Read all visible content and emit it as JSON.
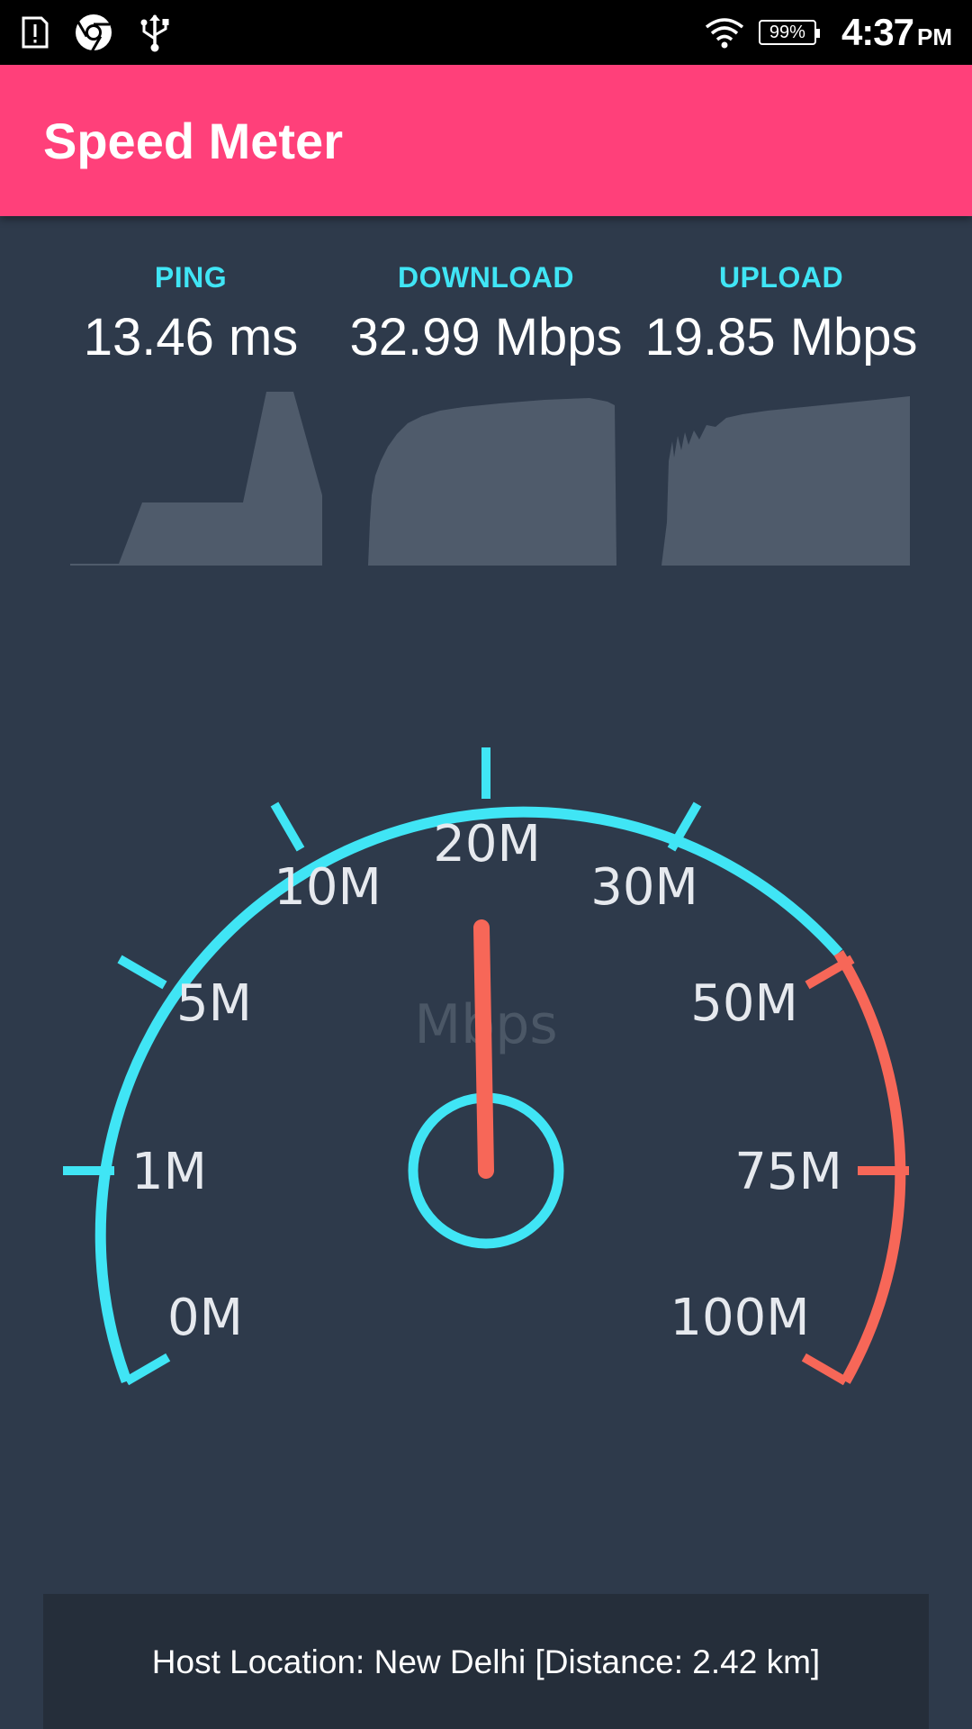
{
  "status_bar": {
    "icons_left": [
      "alert-icon",
      "chrome-icon",
      "usb-icon"
    ],
    "icons_right": [
      "wifi-icon",
      "battery-icon"
    ],
    "battery_percent": "99%",
    "time": "4:37",
    "ampm": "PM"
  },
  "app_bar": {
    "title": "Speed Meter"
  },
  "metrics": {
    "ping": {
      "label": "PING",
      "value": "13.46 ms"
    },
    "download": {
      "label": "DOWNLOAD",
      "value": "32.99 Mbps"
    },
    "upload": {
      "label": "UPLOAD",
      "value": "19.85 Mbps"
    }
  },
  "gauge": {
    "unit": "Mbps",
    "ticks": [
      "0M",
      "1M",
      "5M",
      "10M",
      "20M",
      "30M",
      "50M",
      "75M",
      "100M"
    ],
    "needle_value": "20M",
    "colors": {
      "normal": "#40e5f5",
      "high": "#f76758",
      "needle": "#f76758"
    }
  },
  "host": {
    "text": "Host Location: New Delhi [Distance: 2.42 km]"
  },
  "colors": {
    "accent": "#ff407a",
    "background": "#2e3a4b",
    "label": "#40e5f5"
  }
}
